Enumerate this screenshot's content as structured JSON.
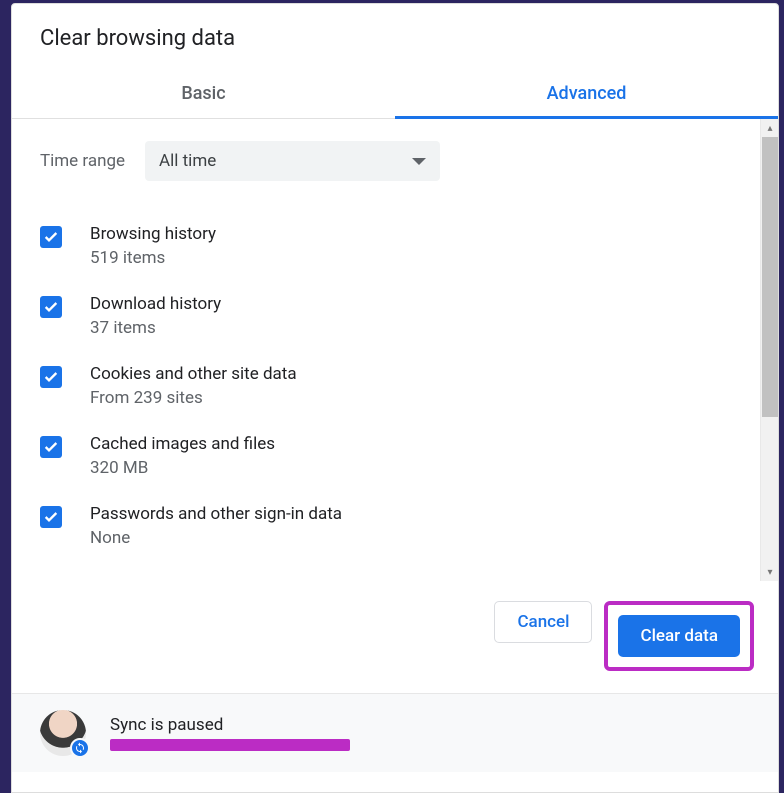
{
  "dialog": {
    "title": "Clear browsing data"
  },
  "tabs": {
    "basic": "Basic",
    "advanced": "Advanced"
  },
  "time_range": {
    "label": "Time range",
    "value": "All time"
  },
  "items": [
    {
      "title": "Browsing history",
      "sub": "519 items",
      "checked": true
    },
    {
      "title": "Download history",
      "sub": "37 items",
      "checked": true
    },
    {
      "title": "Cookies and other site data",
      "sub": "From 239 sites",
      "checked": true
    },
    {
      "title": "Cached images and files",
      "sub": "320 MB",
      "checked": true
    },
    {
      "title": "Passwords and other sign-in data",
      "sub": "None",
      "checked": true
    }
  ],
  "buttons": {
    "cancel": "Cancel",
    "clear": "Clear data"
  },
  "footer": {
    "sync_status": "Sync is paused"
  },
  "colors": {
    "accent": "#1a73e8",
    "highlight": "#bb2cc4"
  }
}
